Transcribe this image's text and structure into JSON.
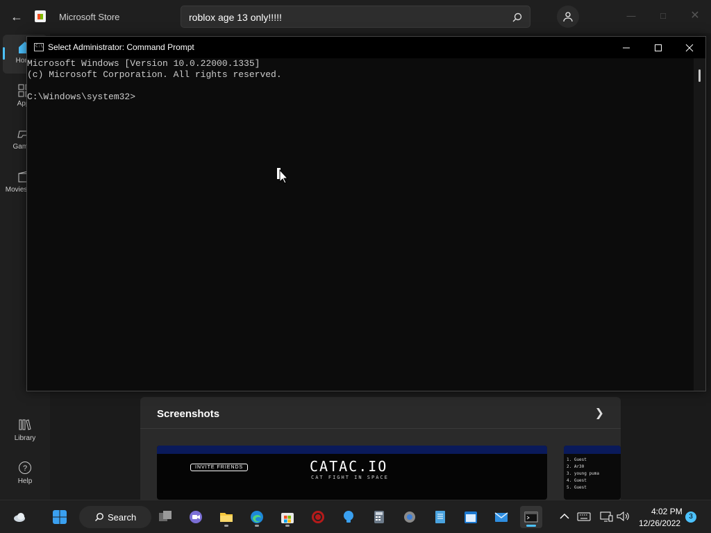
{
  "store": {
    "app_name": "Microsoft Store",
    "search_value": "roblox age 13 only!!!!!",
    "sidebar": [
      {
        "label": "Home",
        "icon": "home-icon"
      },
      {
        "label": "Apps",
        "icon": "apps-icon"
      },
      {
        "label": "Gaming",
        "icon": "gamepad-icon"
      },
      {
        "label": "Movies & TV",
        "icon": "movies-icon"
      }
    ],
    "sidebar_bottom": [
      {
        "label": "Library",
        "icon": "library-icon"
      },
      {
        "label": "Help",
        "icon": "help-icon"
      }
    ],
    "screenshots": {
      "title": "Screenshots",
      "shot1_title": "CATAC.IO",
      "shot1_subtitle": "CAT FIGHT IN SPACE",
      "shot1_invite": "INVITE FRIENDS",
      "leaderboard": [
        "1. Guest",
        "2. Ar30",
        "3. young puma",
        "4. Guest",
        "5. Guest"
      ]
    }
  },
  "cmd": {
    "title": "Select Administrator: Command Prompt",
    "lines": [
      "Microsoft Windows [Version 10.0.22000.1335]",
      "(c) Microsoft Corporation. All rights reserved.",
      "",
      "C:\\Windows\\system32>"
    ]
  },
  "taskbar": {
    "search_label": "Search",
    "apps": [
      "widgets-icon",
      "start-icon",
      "task-view-icon",
      "teams-chat-icon",
      "file-explorer-icon",
      "edge-icon",
      "store-icon",
      "game-app-icon",
      "tips-icon",
      "calculator-icon",
      "settings-icon",
      "notepad-icon",
      "calendar-icon",
      "mail-icon",
      "terminal-icon"
    ],
    "time": "4:02 PM",
    "date": "12/26/2022",
    "notification_count": "3"
  },
  "colors": {
    "accent": "#4cc2ff",
    "cmd_background": "#0c0c0c",
    "cmd_text": "#cccccc"
  }
}
